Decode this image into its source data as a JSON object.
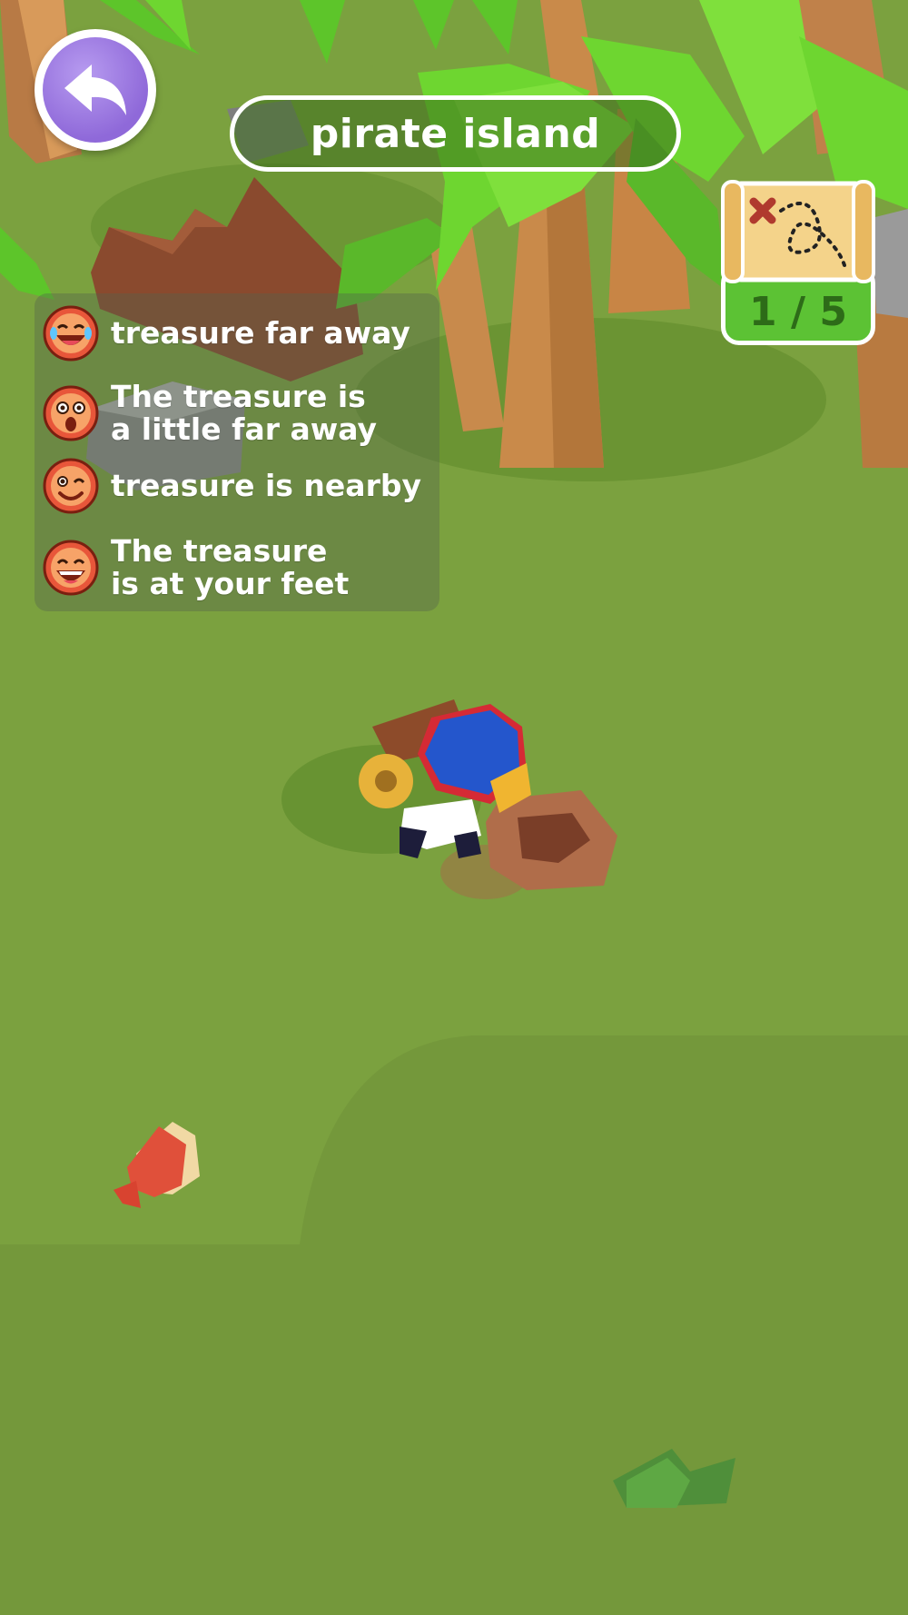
{
  "header": {
    "title": "pirate island",
    "back_icon": "back-arrow-icon"
  },
  "treasure_map": {
    "icon": "treasure-map-icon",
    "found": 1,
    "total": 5,
    "counter_text": "1 / 5"
  },
  "legend": {
    "items": [
      {
        "icon": "crying-laughing-face-icon",
        "label": "treasure far away"
      },
      {
        "icon": "surprised-face-icon",
        "label": "The treasure is a little far away"
      },
      {
        "icon": "winking-face-icon",
        "label": "treasure is nearby"
      },
      {
        "icon": "grinning-face-icon",
        "label": "The treasure is at your feet"
      }
    ]
  },
  "colors": {
    "ground": "#7ba13f",
    "back_button": "#8f69d9",
    "counter_badge": "#5cc234",
    "foliage": "#6ed630"
  }
}
